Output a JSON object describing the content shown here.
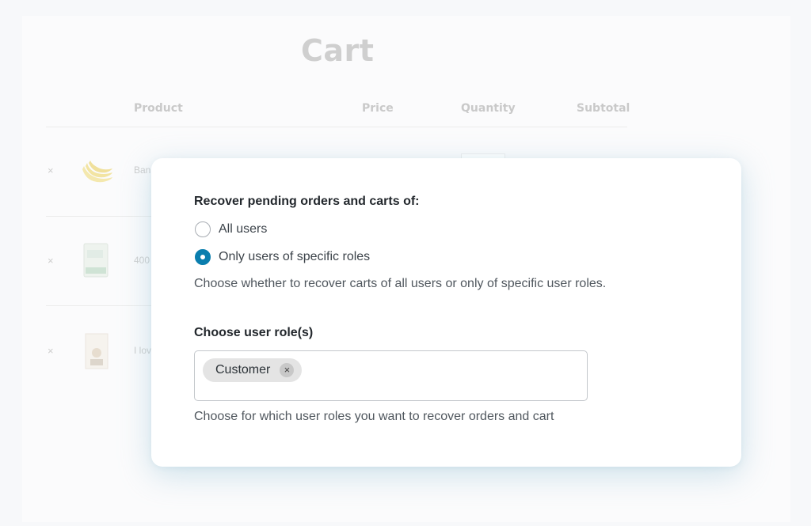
{
  "cart": {
    "title": "Cart",
    "columns": [
      "Product",
      "Price",
      "Quantity",
      "Subtotal"
    ],
    "rows": [
      {
        "remove": "×",
        "name": "Ban"
      },
      {
        "remove": "×",
        "name": "400"
      },
      {
        "remove": "×",
        "name": "I lov"
      }
    ]
  },
  "modal": {
    "recover_label": "Recover pending orders and carts of:",
    "options": [
      {
        "label": "All users",
        "checked": false
      },
      {
        "label": "Only users of specific roles",
        "checked": true
      }
    ],
    "recover_help": "Choose whether to recover carts of all users or only of specific user roles.",
    "roles_label": "Choose user role(s)",
    "selected_roles": [
      {
        "label": "Customer",
        "remove_icon": "×"
      }
    ],
    "roles_help": "Choose for which user roles you want to recover orders and cart"
  },
  "colors": {
    "accent": "#0a7eae",
    "text_dark": "#23282d",
    "text_muted": "#50575e"
  }
}
